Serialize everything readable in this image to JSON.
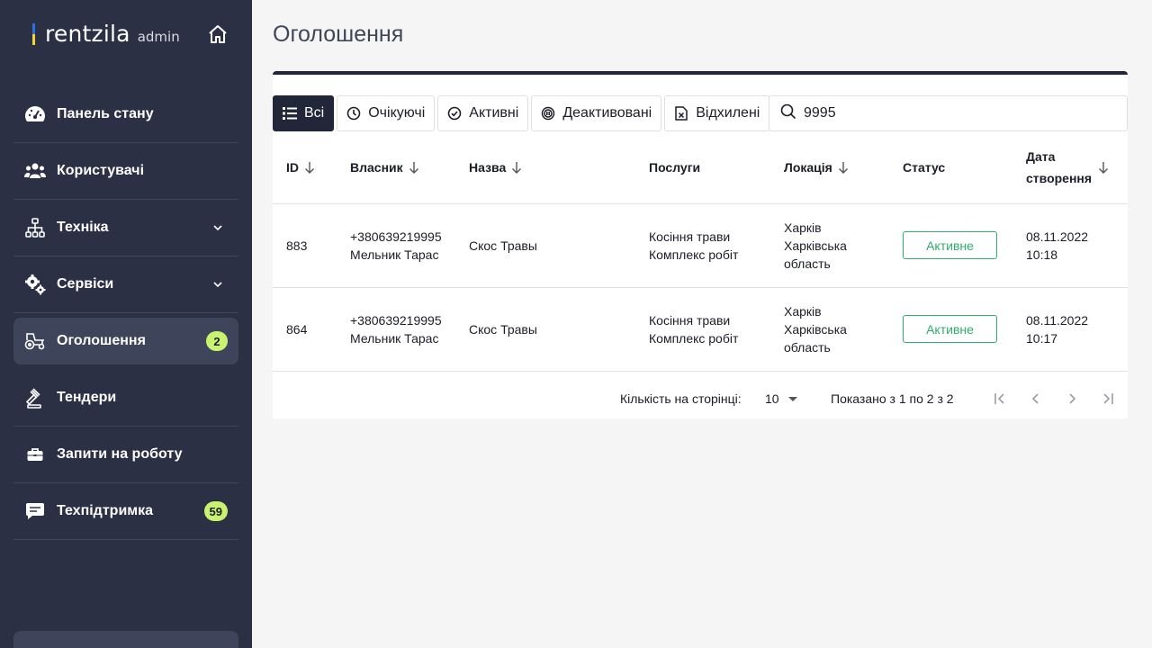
{
  "brand": {
    "name": "rentzila",
    "sub": "admin"
  },
  "sidebar": {
    "items": [
      {
        "label": "Панель стану"
      },
      {
        "label": "Користувачі"
      },
      {
        "label": "Техніка"
      },
      {
        "label": "Сервіси"
      },
      {
        "label": "Оголошення",
        "badge": "2"
      },
      {
        "label": "Тендери"
      },
      {
        "label": "Запити на роботу"
      },
      {
        "label": "Техпідтримка",
        "badge": "59"
      }
    ]
  },
  "page": {
    "title": "Оголошення"
  },
  "filters": {
    "tabs": [
      {
        "label": "Всі"
      },
      {
        "label": "Очікуючі"
      },
      {
        "label": "Активні"
      },
      {
        "label": "Деактивовані"
      },
      {
        "label": "Відхилені"
      }
    ],
    "search_value": "9995"
  },
  "table": {
    "headers": [
      "ID",
      "Власник",
      "Назва",
      "Послуги",
      "Локація",
      "Статус",
      "Дата створення"
    ],
    "rows": [
      {
        "id": "883",
        "owner_phone": "+380639219995",
        "owner_name": "Мельник Тарас",
        "name": "Скос Травы",
        "service_1": "Косіння трави",
        "service_2": "Комплекс робіт",
        "loc_1": "Харків",
        "loc_2": "Харківська",
        "loc_3": "область",
        "status": "Активне",
        "date": "08.11.2022",
        "time": "10:18"
      },
      {
        "id": "864",
        "owner_phone": "+380639219995",
        "owner_name": "Мельник Тарас",
        "name": "Скос Травы",
        "service_1": "Косіння трави",
        "service_2": "Комплекс робіт",
        "loc_1": "Харків",
        "loc_2": "Харківська",
        "loc_3": "область",
        "status": "Активне",
        "date": "08.11.2022",
        "time": "10:17"
      }
    ]
  },
  "pager": {
    "label": "Кількість на сторінці:",
    "size": "10",
    "info": "Показано з 1 по 2 з 2"
  },
  "colors": {
    "sidebar": "#2b3045",
    "accent_green": "#2ead6b",
    "badge": "#c9f271",
    "dark": "#222639"
  }
}
